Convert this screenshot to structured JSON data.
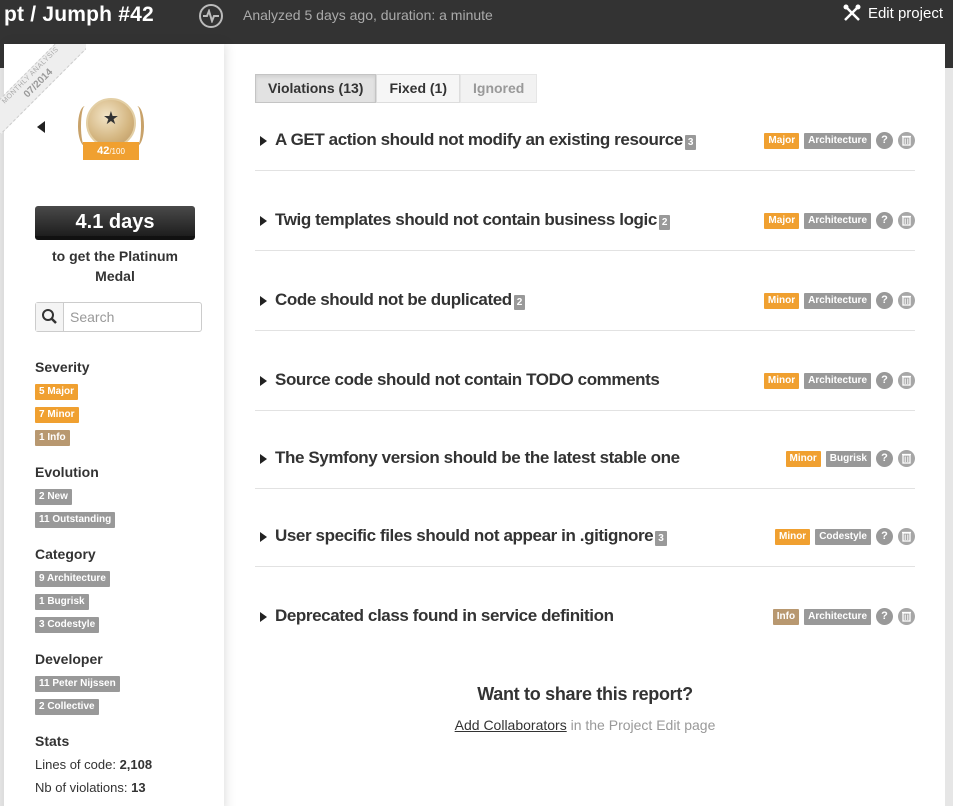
{
  "header": {
    "title": "pt / Jumph #42",
    "analyzed": "Analyzed 5 days ago, duration: a minute",
    "edit_label": "Edit project"
  },
  "ribbon": {
    "line1": "MONTHLY ANALYSIS",
    "line2": "07/2014"
  },
  "medal": {
    "score": "42",
    "max": "/100"
  },
  "progress": {
    "days": "4.1 days",
    "caption": "to get the Platinum Medal"
  },
  "search": {
    "placeholder": "Search",
    "value": ""
  },
  "facets": {
    "severity": {
      "title": "Severity",
      "items": [
        "5 Major",
        "7 Minor",
        "1 Info"
      ]
    },
    "evolution": {
      "title": "Evolution",
      "items": [
        "2 New",
        "11 Outstanding"
      ]
    },
    "category": {
      "title": "Category",
      "items": [
        "9 Architecture",
        "1 Bugrisk",
        "3 Codestyle"
      ]
    },
    "developer": {
      "title": "Developer",
      "items": [
        "11 Peter Nijssen",
        "2 Collective"
      ]
    }
  },
  "stats": {
    "title": "Stats",
    "loc_label": "Lines of code:",
    "loc_value": "2,108",
    "nbv_label": "Nb of violations:",
    "nbv_value": "13"
  },
  "tabs": [
    "Violations (13)",
    "Fixed (1)",
    "Ignored"
  ],
  "violations": [
    {
      "title": "A GET action should not modify an existing resource",
      "count": "3",
      "severity": "Major",
      "category": "Architecture"
    },
    {
      "title": "Twig templates should not contain business logic",
      "count": "2",
      "severity": "Major",
      "category": "Architecture"
    },
    {
      "title": "Code should not be duplicated",
      "count": "2",
      "severity": "Minor",
      "category": "Architecture"
    },
    {
      "title": "Source code should not contain TODO comments",
      "count": "",
      "severity": "Minor",
      "category": "Architecture"
    },
    {
      "title": "The Symfony version should be the latest stable one",
      "count": "",
      "severity": "Minor",
      "category": "Bugrisk"
    },
    {
      "title": "User specific files should not appear in .gitignore",
      "count": "3",
      "severity": "Minor",
      "category": "Codestyle"
    },
    {
      "title": "Deprecated class found in service definition",
      "count": "",
      "severity": "Info",
      "category": "Architecture"
    }
  ],
  "help_glyph": "?",
  "share": {
    "title": "Want to share this report?",
    "link": "Add Collaborators",
    "suffix": " in the Project Edit page"
  },
  "colors": {
    "topbar": "#333333",
    "major": "#f0a030",
    "minor": "#f0a030",
    "info": "#b89870",
    "grey": "#999999"
  },
  "icons": [
    "pulse-icon",
    "wrench-icon",
    "back-arrow-icon",
    "medal-icon",
    "search-icon",
    "expand-icon",
    "help-icon",
    "trash-icon"
  ]
}
